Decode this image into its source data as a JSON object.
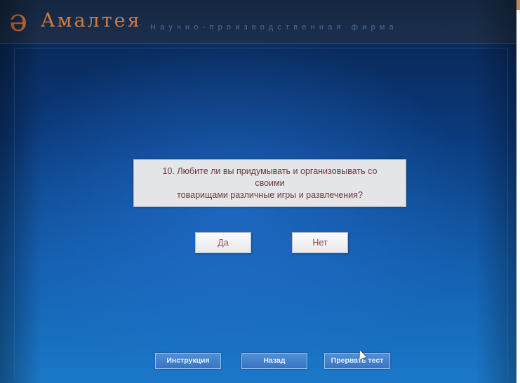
{
  "header": {
    "logo_glyph": "ə",
    "brand_name": "Амалтея",
    "brand_subtitle": "Научно-производственная фирма"
  },
  "question": {
    "line1": "10. Любите ли вы придумывать и организовывать со своими",
    "line2": "товарищами различные игры и развлечения?"
  },
  "answers": {
    "yes_label": "Да",
    "no_label": "Нет"
  },
  "nav": {
    "instructions_label": "Инструкция",
    "back_label": "Назад",
    "stop_label": "Прервать тест"
  },
  "colors": {
    "brand": "#d7783c",
    "background_top": "#08214a",
    "background_bottom": "#1b78c8",
    "nav_button": "#3a74c0",
    "question_box": "#e3e5e9"
  },
  "icons": {
    "logo": "amalteya-logo-icon",
    "cursor": "mouse-pointer-icon"
  }
}
